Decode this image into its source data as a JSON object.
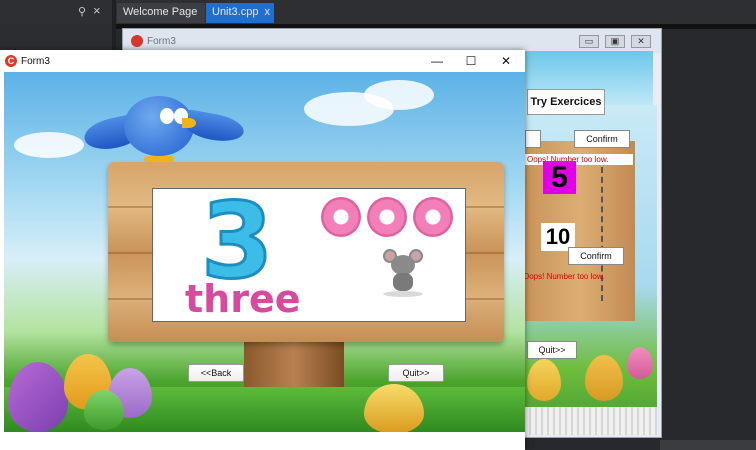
{
  "ide": {
    "tabs": [
      {
        "label": "Welcome Page"
      },
      {
        "label": "Unit3.cpp",
        "close": "x"
      }
    ],
    "pin_glyph": "⚲",
    "close_glyph": "×"
  },
  "designer": {
    "title": "Form3",
    "try_button": "Try Exercices",
    "confirm_label": "Confirm",
    "message": "Oops! Number too low.",
    "number_five": "5",
    "number_ten": "10",
    "quit_label": "Quit>>",
    "window_buttons": [
      "▭",
      "▣",
      "✕"
    ]
  },
  "form3": {
    "title": "Form3",
    "icon_letter": "C",
    "window_controls": {
      "minimize": "—",
      "maximize": "☐",
      "close": "✕"
    },
    "card": {
      "digit": "3",
      "word": "three",
      "donut_count": 3
    },
    "back_button": "<<Back",
    "quit_button": "Quit>>"
  },
  "colors": {
    "ide_bg": "#2b2d30",
    "active_tab": "#1f6fd1",
    "digit_blue": "#3bbde8",
    "word_pink": "#d84a9e",
    "highlight_magenta": "#e000e6",
    "error_red": "#dd0000"
  },
  "icons": [
    "pin-icon",
    "close-icon",
    "app-c-icon",
    "minimize-icon",
    "maximize-icon",
    "window-close-icon"
  ]
}
